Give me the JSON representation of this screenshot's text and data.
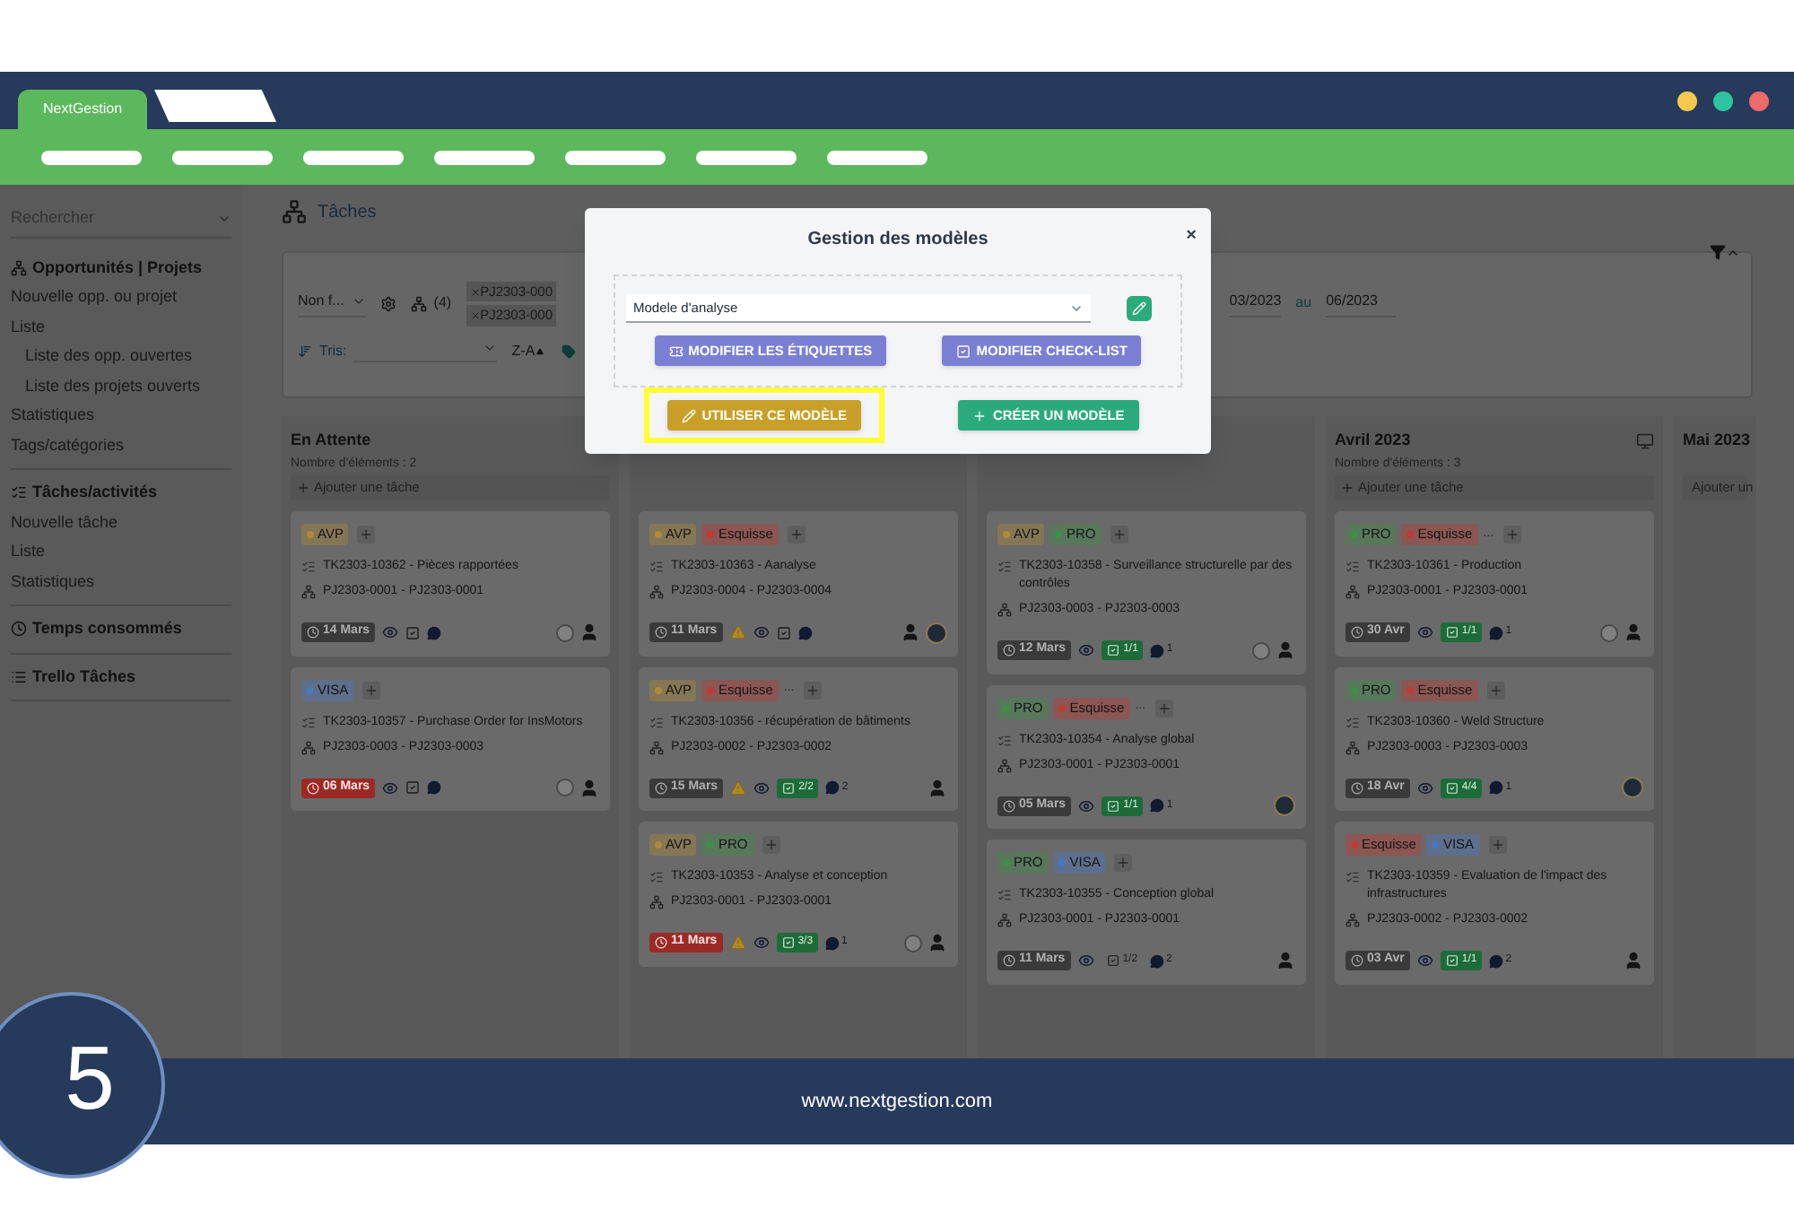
{
  "browser": {
    "tab_label": "NextGestion"
  },
  "sidebar": {
    "search_placeholder": "Rechercher",
    "sections": [
      {
        "title": "Opportunités | Projets",
        "items": [
          {
            "label": "Nouvelle opp. ou projet"
          },
          {
            "label": "Liste",
            "children": [
              {
                "label": "Liste des opp. ouvertes"
              },
              {
                "label": "Liste des projets ouverts"
              }
            ]
          },
          {
            "label": "Statistiques"
          },
          {
            "label": "Tags/catégories"
          }
        ]
      },
      {
        "title": "Tâches/activités",
        "items": [
          {
            "label": "Nouvelle tâche"
          },
          {
            "label": "Liste"
          },
          {
            "label": "Statistiques"
          }
        ]
      },
      {
        "title": "Temps consommés"
      },
      {
        "title": "Trello Tâches"
      }
    ]
  },
  "page_title": "Tâches",
  "filters": {
    "status": "Non f...",
    "count": "(4)",
    "chips": [
      "PJ2303-000",
      "PJ2303-000"
    ],
    "date_from": "03/2023",
    "date_sep": "au",
    "date_to": "06/2023",
    "sort_label": "Tris:",
    "order": "Z-A"
  },
  "board": {
    "columns": [
      {
        "title": "En Attente",
        "count": "Nombre d'éléments : 2",
        "add": "Ajouter une tâche",
        "cards": [
          {
            "tags": [
              {
                "label": "AVP",
                "color": "#b08a3a"
              }
            ],
            "task": "TK2303-10362 - Pièces rapportées",
            "project": "PJ2303-0001 - PJ2303-0001",
            "date": "14 Mars",
            "overdue": false,
            "warning": false,
            "assignees": [
              {
                "kind": "empty"
              },
              {
                "kind": "user"
              }
            ]
          },
          {
            "tags": [
              {
                "label": "VISA",
                "color": "#4a78c0"
              }
            ],
            "task": "TK2303-10357 - Purchase Order for InsMotors",
            "project": "PJ2303-0003 - PJ2303-0003",
            "date": "06 Mars",
            "overdue": true,
            "warning": false,
            "assignees": [
              {
                "kind": "empty"
              },
              {
                "kind": "user"
              }
            ]
          }
        ]
      },
      {
        "cards": [
          {
            "tags": [
              {
                "label": "AVP",
                "color": "#b08a3a"
              },
              {
                "label": "Esquisse",
                "color": "#c03a33"
              }
            ],
            "task": "TK2303-10363 - Aanalyse",
            "project": "PJ2303-0004 - PJ2303-0004",
            "date": "11 Mars",
            "overdue": false,
            "warning": true,
            "assignees": [
              {
                "kind": "user"
              },
              {
                "kind": "photo"
              }
            ]
          },
          {
            "tags": [
              {
                "label": "AVP",
                "color": "#b08a3a"
              },
              {
                "label": "Esquisse",
                "color": "#c03a33"
              }
            ],
            "more": "...",
            "task": "TK2303-10356 - récupération de bâtiments",
            "project": "PJ2303-0002 - PJ2303-0002",
            "date": "15 Mars",
            "overdue": false,
            "warning": true,
            "checklist": {
              "text": "2/2",
              "complete": true
            },
            "comments": "2",
            "assignees": [
              {
                "kind": "user"
              }
            ]
          },
          {
            "tags": [
              {
                "label": "AVP",
                "color": "#b08a3a"
              },
              {
                "label": "PRO",
                "color": "#3f8f45"
              }
            ],
            "task": "TK2303-10353 - Analyse et conception",
            "project": "PJ2303-0001 - PJ2303-0001",
            "date": "11 Mars",
            "overdue": true,
            "warning": true,
            "checklist": {
              "text": "3/3",
              "complete": true
            },
            "comments": "1",
            "assignees": [
              {
                "kind": "empty"
              },
              {
                "kind": "user"
              }
            ]
          }
        ]
      },
      {
        "cards": [
          {
            "tags": [
              {
                "label": "AVP",
                "color": "#b08a3a"
              },
              {
                "label": "PRO",
                "color": "#3f8f45"
              }
            ],
            "task": "TK2303-10358 - Surveillance structurelle par des contrôles",
            "project": "PJ2303-0003 - PJ2303-0003",
            "date": "12 Mars",
            "overdue": false,
            "warning": false,
            "checklist": {
              "text": "1/1",
              "complete": true
            },
            "comments": "1",
            "assignees": [
              {
                "kind": "empty"
              },
              {
                "kind": "user"
              }
            ]
          },
          {
            "tags": [
              {
                "label": "PRO",
                "color": "#3f8f45"
              },
              {
                "label": "Esquisse",
                "color": "#c03a33"
              }
            ],
            "more": "...",
            "task": "TK2303-10354 - Analyse global",
            "project": "PJ2303-0001 - PJ2303-0001",
            "date": "05 Mars",
            "overdue": false,
            "warning": false,
            "checklist": {
              "text": "1/1",
              "complete": true
            },
            "comments": "1",
            "assignees": [
              {
                "kind": "photo"
              }
            ]
          },
          {
            "tags": [
              {
                "label": "PRO",
                "color": "#3f8f45"
              },
              {
                "label": "VISA",
                "color": "#4a78c0"
              }
            ],
            "task": "TK2303-10355 - Conception global",
            "project": "PJ2303-0001 - PJ2303-0001",
            "date": "11 Mars",
            "overdue": false,
            "warning": false,
            "checklist": {
              "text": "1/2",
              "complete": false
            },
            "comments": "2",
            "assignees": [
              {
                "kind": "user"
              }
            ]
          }
        ]
      },
      {
        "title": "Avril 2023",
        "count": "Nombre d'éléments : 3",
        "add": "Ajouter une tâche",
        "cards": [
          {
            "tags": [
              {
                "label": "PRO",
                "color": "#3f8f45"
              },
              {
                "label": "Esquisse",
                "color": "#c03a33"
              }
            ],
            "more": "...",
            "task": "TK2303-10361 - Production",
            "project": "PJ2303-0001 - PJ2303-0001",
            "date": "30 Avr",
            "overdue": false,
            "warning": false,
            "checklist": {
              "text": "1/1",
              "complete": true
            },
            "comments": "1",
            "assignees": [
              {
                "kind": "empty"
              },
              {
                "kind": "user"
              }
            ]
          },
          {
            "tags": [
              {
                "label": "PRO",
                "color": "#3f8f45"
              },
              {
                "label": "Esquisse",
                "color": "#c03a33"
              }
            ],
            "task": "TK2303-10360 - Weld Structure",
            "project": "PJ2303-0003 - PJ2303-0003",
            "date": "18 Avr",
            "overdue": false,
            "warning": false,
            "checklist": {
              "text": "4/4",
              "complete": true
            },
            "comments": "1",
            "assignees": [
              {
                "kind": "photo"
              }
            ]
          },
          {
            "tags": [
              {
                "label": "Esquisse",
                "color": "#c03a33"
              },
              {
                "label": "VISA",
                "color": "#4a78c0"
              }
            ],
            "task": "TK2303-10359 - Evaluation de l'impact des infrastructures",
            "project": "PJ2303-0002 - PJ2303-0002",
            "date": "03 Avr",
            "overdue": false,
            "warning": false,
            "checklist": {
              "text": "1/1",
              "complete": true
            },
            "comments": "2",
            "assignees": [
              {
                "kind": "user"
              }
            ]
          }
        ]
      },
      {
        "title": "Mai 2023",
        "add": "Ajouter un"
      }
    ]
  },
  "modal": {
    "title": "Gestion des modèles",
    "close": "×",
    "model": "Modele d'analyse",
    "buttons": [
      {
        "label": "MODIFIER LES ÉTIQUETTES",
        "kind": "labels",
        "highlighted": false
      },
      {
        "label": "MODIFIER CHECK-LIST",
        "kind": "checklist",
        "highlighted": false
      },
      {
        "label": "UTILISER CE MODÈLE",
        "kind": "use",
        "highlighted": true
      },
      {
        "label": "CRÉER UN MODÈLE",
        "kind": "create",
        "highlighted": false
      }
    ]
  },
  "footer": {
    "url": "www.nextgestion.com",
    "step": "5"
  }
}
